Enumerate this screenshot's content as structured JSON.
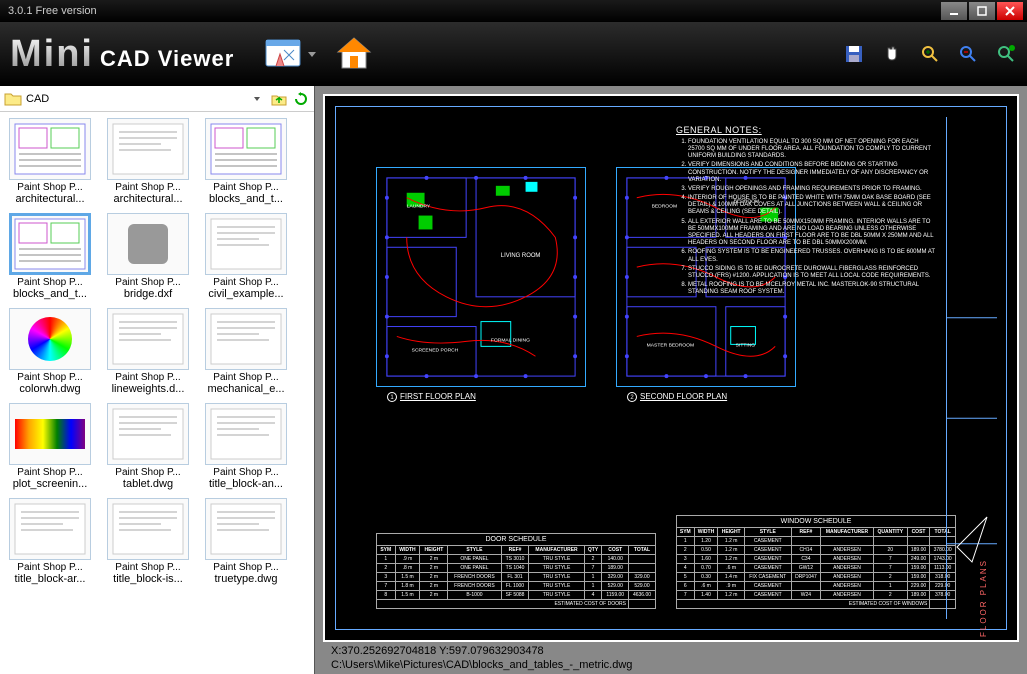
{
  "window": {
    "title": "3.0.1 Free version"
  },
  "brand": {
    "logo": "Mini",
    "sub": "CAD Viewer"
  },
  "breadcrumb": {
    "folder": "CAD"
  },
  "thumbs": [
    {
      "type": "Paint Shop P...",
      "name": "architectural...",
      "preview": "cad",
      "selected": false
    },
    {
      "type": "Paint Shop P...",
      "name": "architectural...",
      "preview": "doc",
      "selected": false
    },
    {
      "type": "Paint Shop P...",
      "name": "blocks_and_t...",
      "preview": "cad",
      "selected": false
    },
    {
      "type": "Paint Shop P...",
      "name": "blocks_and_t...",
      "preview": "cad",
      "selected": true
    },
    {
      "type": "Paint Shop P...",
      "name": "bridge.dxf",
      "preview": "gimp",
      "selected": false
    },
    {
      "type": "Paint Shop P...",
      "name": "civil_example...",
      "preview": "doc",
      "selected": false
    },
    {
      "type": "Paint Shop P...",
      "name": "colorwh.dwg",
      "preview": "color",
      "selected": false
    },
    {
      "type": "Paint Shop P...",
      "name": "lineweights.d...",
      "preview": "doc",
      "selected": false
    },
    {
      "type": "Paint Shop P...",
      "name": "mechanical_e...",
      "preview": "doc",
      "selected": false
    },
    {
      "type": "Paint Shop P...",
      "name": "plot_screenin...",
      "preview": "grad",
      "selected": false
    },
    {
      "type": "Paint Shop P...",
      "name": "tablet.dwg",
      "preview": "doc",
      "selected": false
    },
    {
      "type": "Paint Shop P...",
      "name": "title_block-an...",
      "preview": "doc",
      "selected": false
    },
    {
      "type": "Paint Shop P...",
      "name": "title_block-ar...",
      "preview": "doc",
      "selected": false
    },
    {
      "type": "Paint Shop P...",
      "name": "title_block-is...",
      "preview": "doc",
      "selected": false
    },
    {
      "type": "Paint Shop P...",
      "name": "truetype.dwg",
      "preview": "doc",
      "selected": false
    }
  ],
  "drawing": {
    "notes_title": "GENERAL NOTES:",
    "notes": [
      "FOUNDATION VENTILATION EQUAL TO 300 SQ MM OF NET OPENING FOR EACH 25700 SQ MM OF UNDER FLOOR AREA. ALL FOUNDATION TO COMPLY TO CURRENT UNIFORM BUILDING STANDARDS.",
      "VERIFY DIMENSIONS AND CONDITIONS BEFORE BIDDING OR STARTING CONSTRUCTION. NOTIFY THE DESIGNER IMMEDIATELY OF ANY DISCREPANCY OR VARIATION.",
      "VERIFY ROUGH OPENINGS AND FRAMING REQUIREMENTS PRIOR TO FRAMING.",
      "INTERIOR OF HOUSE IS TO BE PAINTED WHITE WITH 75MM OAK BASE BOARD (SEE DETAIL) & 100MM OAK COVES AT ALL JUNCTIONS BETWEEN WALL & CEILING OR BEAMS & CEILING (SEE DETAIL).",
      "ALL EXTERIOR WALL ARE TO BE 50MMX150MM FRAMING. INTERIOR WALLS ARE TO BE 50MMX100MM FRAMING AND ARE NO LOAD BEARING UNLESS OTHERWISE SPECIFIED. ALL HEADERS ON FIRST FLOOR ARE TO BE DBL 50MM X 250MM AND ALL HEADERS ON SECOND FLOOR ARE TO BE DBL 50MMX200MM.",
      "ROOFING SYSTEM IS TO BE ENGINEERED TRUSSES. OVERHANG IS TO BE 600MM AT ALL EVES.",
      "STUCCO SIDING IS TO BE DUROCRETE DUROWALL FIBERGLASS REINFORCED STUCCO (FRS) #1200. APPLICATION IS TO MEET ALL LOCAL CODE REQUIREMENTS.",
      "METAL ROOFING IS TO BE MCELROY METAL INC. MASTERLOK-90 STRUCTURAL STANDING SEAM ROOF SYSTEM."
    ],
    "floor1_label": "FIRST FLOOR PLAN",
    "floor2_label": "SECOND FLOOR PLAN",
    "door_schedule_title": "DOOR SCHEDULE",
    "window_schedule_title": "WINDOW SCHEDULE",
    "title_block_label": "FLOOR PLANS",
    "door_headers": [
      "SYM",
      "WIDTH",
      "HEIGHT",
      "STYLE",
      "REF#",
      "MANUFACTURER",
      "QTY",
      "COST",
      "TOTAL"
    ],
    "door_rows": [
      [
        "1",
        ".9 m",
        "2 m",
        "ONE PANEL",
        "TS 3010",
        "TRU STYLE",
        "2",
        "140.00",
        ""
      ],
      [
        "2",
        ".8 m",
        "2 m",
        "ONE PANEL",
        "TS 1040",
        "TRU STYLE",
        "7",
        "189.00",
        ""
      ],
      [
        "3",
        "1.5 m",
        "2 m",
        "FRENCH DOORS",
        "FL 301",
        "TRU STYLE",
        "1",
        "329.00",
        "329.00"
      ],
      [
        "7",
        "1.8 m",
        "2 m",
        "FRENCH DOORS",
        "FL 1000",
        "TRU STYLE",
        "1",
        "529.00",
        "529.00"
      ],
      [
        "8",
        "1.5 m",
        "2 m",
        "B-1000",
        "SF 5088",
        "TRU STYLE",
        "4",
        "1159.00",
        "4636.00"
      ]
    ],
    "door_footer": "ESTIMATED COST OF DOORS",
    "window_headers": [
      "SYM",
      "WIDTH",
      "HEIGHT",
      "STYLE",
      "REF#",
      "MANUFACTURER",
      "QUANTITY",
      "COST",
      "TOTAL"
    ],
    "window_rows": [
      [
        "1",
        "1.20",
        "1.2 m",
        "CASEMENT",
        "",
        "",
        "",
        "",
        ""
      ],
      [
        "2",
        "0.50",
        "1.2 m",
        "CASEMENT",
        "CH14",
        "ANDERSEN",
        "20",
        "189.00",
        "3780.00"
      ],
      [
        "3",
        "1.60",
        "1.2 m",
        "CASEMENT",
        "C34",
        "ANDERSEN",
        "7",
        "249.00",
        "1743.00"
      ],
      [
        "4",
        "0.70",
        ".6 m",
        "CASEMENT",
        "GW12",
        "ANDERSEN",
        "7",
        "159.00",
        "1113.00"
      ],
      [
        "5",
        "0.30",
        "1.4 m",
        "FIX CASEMENT",
        "DRP1047",
        "ANDERSEN",
        "2",
        "159.00",
        "318.00"
      ],
      [
        "6",
        ".6 m",
        ".9 m",
        "CASEMENT",
        "",
        "ANDERSEN",
        "1",
        "229.00",
        "229.00"
      ],
      [
        "7",
        "1.40",
        "1.2 m",
        "CASEMENT",
        "W24",
        "ANDERSEN",
        "2",
        "189.00",
        "378.00"
      ]
    ],
    "window_footer": "ESTIMATED COST OF WINDOWS"
  },
  "status": {
    "coords": "X:370.252692704818   Y:597.079632903478",
    "path": "C:\\Users\\Mike\\Pictures\\CAD\\blocks_and_tables_-_metric.dwg"
  }
}
